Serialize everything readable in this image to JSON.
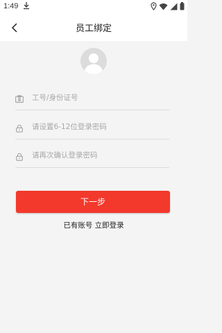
{
  "status_bar": {
    "time": "1:49"
  },
  "header": {
    "title": "员工绑定"
  },
  "form": {
    "id_placeholder": "工号/身份证号",
    "password_placeholder": "请设置6-12位登录密码",
    "confirm_placeholder": "请再次确认登录密码"
  },
  "actions": {
    "next_label": "下一步",
    "login_link": "已有账号 立即登录"
  },
  "colors": {
    "accent": "#f2392c",
    "background": "#f4f4f4"
  }
}
